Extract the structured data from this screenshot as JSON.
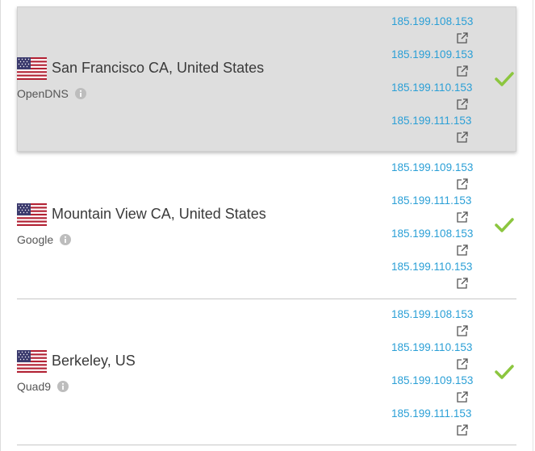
{
  "colors": {
    "link": "#2a9fd6",
    "check": "#8cc63f",
    "highlight_bg": "#dedede",
    "divider": "#c8c8c8"
  },
  "servers": [
    {
      "location": "San Francisco CA, United States",
      "provider": "OpenDNS",
      "flag_icon": "us-flag-icon",
      "status_icon": "checkmark-icon",
      "ips": [
        "185.199.108.153",
        "185.199.109.153",
        "185.199.110.153",
        "185.199.111.153"
      ],
      "highlighted": true
    },
    {
      "location": "Mountain View CA, United States",
      "provider": "Google",
      "flag_icon": "us-flag-icon",
      "status_icon": "checkmark-icon",
      "ips": [
        "185.199.109.153",
        "185.199.111.153",
        "185.199.108.153",
        "185.199.110.153"
      ],
      "highlighted": false
    },
    {
      "location": "Berkeley, US",
      "provider": "Quad9",
      "flag_icon": "us-flag-icon",
      "status_icon": "checkmark-icon",
      "ips": [
        "185.199.108.153",
        "185.199.110.153",
        "185.199.109.153",
        "185.199.111.153"
      ],
      "highlighted": false
    }
  ]
}
